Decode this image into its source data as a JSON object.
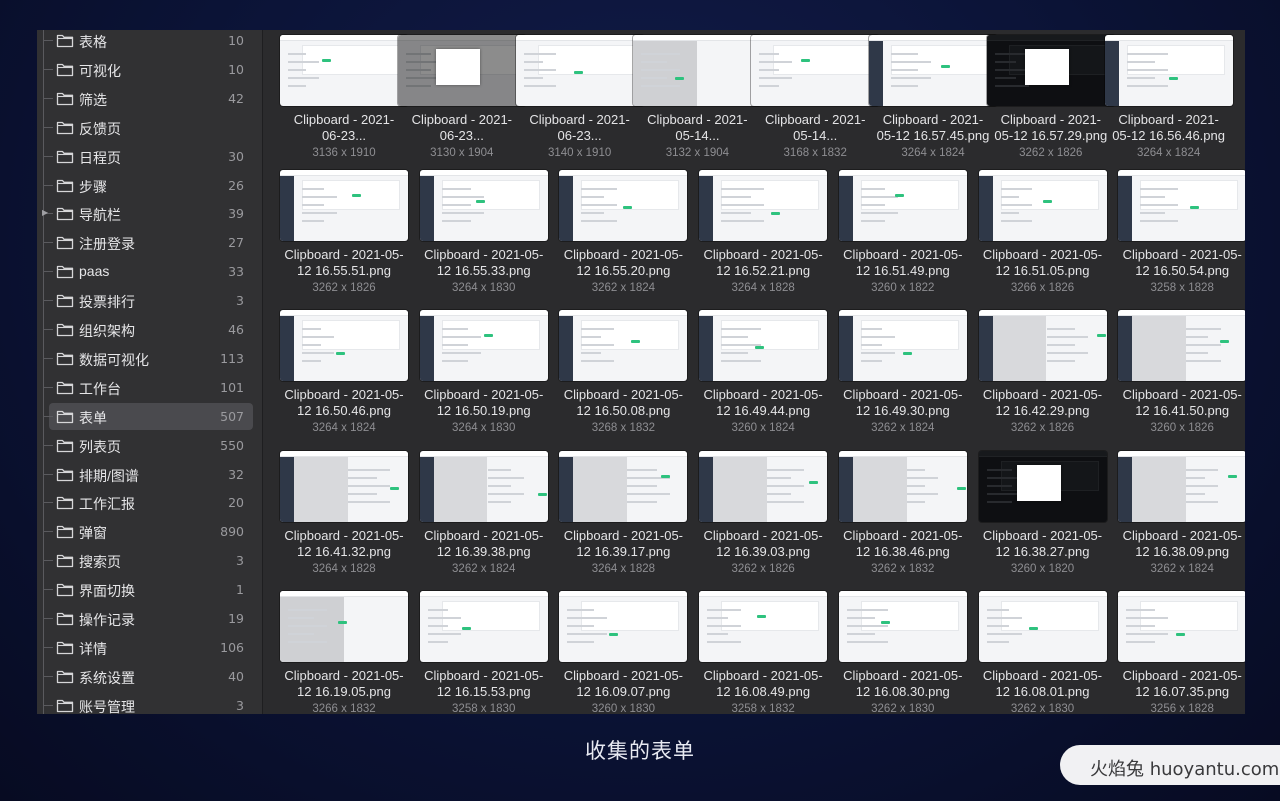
{
  "sidebar": {
    "selected_index": 13,
    "items": [
      {
        "label": "表格",
        "count": "10"
      },
      {
        "label": "可视化",
        "count": "10"
      },
      {
        "label": "筛选",
        "count": "42"
      },
      {
        "label": "反馈页",
        "count": ""
      },
      {
        "label": "日程页",
        "count": "30"
      },
      {
        "label": "步骤",
        "count": "26"
      },
      {
        "label": "导航栏",
        "count": "39",
        "expandable": true
      },
      {
        "label": "注册登录",
        "count": "27"
      },
      {
        "label": "paas",
        "count": "33"
      },
      {
        "label": "投票排行",
        "count": "3"
      },
      {
        "label": "组织架构",
        "count": "46"
      },
      {
        "label": "数据可视化",
        "count": "113"
      },
      {
        "label": "工作台",
        "count": "101"
      },
      {
        "label": "表单",
        "count": "507"
      },
      {
        "label": "列表页",
        "count": "550"
      },
      {
        "label": "排期/图谱",
        "count": "32"
      },
      {
        "label": "工作汇报",
        "count": "20"
      },
      {
        "label": "弹窗",
        "count": "890"
      },
      {
        "label": "搜索页",
        "count": "3"
      },
      {
        "label": "界面切换",
        "count": "1"
      },
      {
        "label": "操作记录",
        "count": "19"
      },
      {
        "label": "详情",
        "count": "106"
      },
      {
        "label": "系统设置",
        "count": "40"
      },
      {
        "label": "账号管理",
        "count": "3"
      }
    ]
  },
  "files": [
    {
      "line1": "Clipboard - 2021-",
      "line2": "06-23...",
      "dims": "3136 x 1910",
      "style": "plain"
    },
    {
      "line1": "Clipboard - 2021-",
      "line2": "06-23...",
      "dims": "3130 x 1904",
      "style": "modal"
    },
    {
      "line1": "Clipboard - 2021-",
      "line2": "06-23...",
      "dims": "3140 x 1910",
      "style": "plain"
    },
    {
      "line1": "Clipboard - 2021-",
      "line2": "05-14...",
      "dims": "3132 x 1904",
      "style": "split"
    },
    {
      "line1": "Clipboard - 2021-",
      "line2": "05-14...",
      "dims": "3168 x 1832",
      "style": "plain"
    },
    {
      "line1": "Clipboard - 2021-",
      "line2": "05-12 16.57.45.png",
      "dims": "3264 x 1824",
      "style": "nav"
    },
    {
      "line1": "Clipboard - 2021-",
      "line2": "05-12 16.57.29.png",
      "dims": "3262 x 1826",
      "style": "darkmodal"
    },
    {
      "line1": "Clipboard - 2021-",
      "line2": "05-12 16.56.46.png",
      "dims": "3264 x 1824",
      "style": "nav"
    },
    {
      "line1": "Clipboard - 2021-05-",
      "line2": "12 16.55.51.png",
      "dims": "3262 x 1826",
      "style": "nav"
    },
    {
      "line1": "Clipboard - 2021-05-",
      "line2": "12 16.55.33.png",
      "dims": "3264 x 1830",
      "style": "nav"
    },
    {
      "line1": "Clipboard - 2021-05-",
      "line2": "12 16.55.20.png",
      "dims": "3262 x 1824",
      "style": "nav"
    },
    {
      "line1": "Clipboard - 2021-05-",
      "line2": "12 16.52.21.png",
      "dims": "3264 x 1828",
      "style": "nav"
    },
    {
      "line1": "Clipboard - 2021-05-",
      "line2": "12 16.51.49.png",
      "dims": "3260 x 1822",
      "style": "nav"
    },
    {
      "line1": "Clipboard - 2021-05-",
      "line2": "12 16.51.05.png",
      "dims": "3266 x 1826",
      "style": "nav"
    },
    {
      "line1": "Clipboard - 2021-05-",
      "line2": "12 16.50.54.png",
      "dims": "3258 x 1828",
      "style": "nav"
    },
    {
      "line1": "Clipboard - 2021-05-",
      "line2": "12 16.50.46.png",
      "dims": "3264 x 1824",
      "style": "nav"
    },
    {
      "line1": "Clipboard - 2021-05-",
      "line2": "12 16.50.19.png",
      "dims": "3264 x 1830",
      "style": "nav"
    },
    {
      "line1": "Clipboard - 2021-05-",
      "line2": "12 16.50.08.png",
      "dims": "3268 x 1832",
      "style": "nav"
    },
    {
      "line1": "Clipboard - 2021-05-",
      "line2": "12 16.49.44.png",
      "dims": "3260 x 1824",
      "style": "nav"
    },
    {
      "line1": "Clipboard - 2021-05-",
      "line2": "12 16.49.30.png",
      "dims": "3262 x 1824",
      "style": "nav"
    },
    {
      "line1": "Clipboard - 2021-05-",
      "line2": "12 16.42.29.png",
      "dims": "3262 x 1826",
      "style": "grayside"
    },
    {
      "line1": "Clipboard - 2021-05-",
      "line2": "12 16.41.50.png",
      "dims": "3260 x 1826",
      "style": "grayside"
    },
    {
      "line1": "Clipboard - 2021-05-",
      "line2": "12 16.41.32.png",
      "dims": "3264 x 1828",
      "style": "grayside"
    },
    {
      "line1": "Clipboard - 2021-05-",
      "line2": "12 16.39.38.png",
      "dims": "3262 x 1824",
      "style": "grayside"
    },
    {
      "line1": "Clipboard - 2021-05-",
      "line2": "12 16.39.17.png",
      "dims": "3264 x 1828",
      "style": "grayside"
    },
    {
      "line1": "Clipboard - 2021-05-",
      "line2": "12 16.39.03.png",
      "dims": "3262 x 1826",
      "style": "grayside"
    },
    {
      "line1": "Clipboard - 2021-05-",
      "line2": "12 16.38.46.png",
      "dims": "3262 x 1832",
      "style": "grayside"
    },
    {
      "line1": "Clipboard - 2021-05-",
      "line2": "12 16.38.27.png",
      "dims": "3260 x 1820",
      "style": "darkmodal"
    },
    {
      "line1": "Clipboard - 2021-05-",
      "line2": "12 16.38.09.png",
      "dims": "3262 x 1824",
      "style": "grayside"
    },
    {
      "line1": "Clipboard - 2021-05-",
      "line2": "12 16.19.05.png",
      "dims": "3266 x 1832",
      "style": "split"
    },
    {
      "line1": "Clipboard - 2021-05-",
      "line2": "12 16.15.53.png",
      "dims": "3258 x 1830",
      "style": "plain"
    },
    {
      "line1": "Clipboard - 2021-05-",
      "line2": "12 16.09.07.png",
      "dims": "3260 x 1830",
      "style": "plain"
    },
    {
      "line1": "Clipboard - 2021-05-",
      "line2": "12 16.08.49.png",
      "dims": "3258 x 1832",
      "style": "plain"
    },
    {
      "line1": "Clipboard - 2021-05-",
      "line2": "12 16.08.30.png",
      "dims": "3262 x 1830",
      "style": "plain"
    },
    {
      "line1": "Clipboard - 2021-05-",
      "line2": "12 16.08.01.png",
      "dims": "3262 x 1830",
      "style": "plain"
    },
    {
      "line1": "Clipboard - 2021-05-",
      "line2": "12 16.07.35.png",
      "dims": "3256 x 1828",
      "style": "plain"
    }
  ],
  "caption": "收集的表单",
  "watermark": "火焰兔 huoyantu.com",
  "colors": {
    "accent": "#2ec27e",
    "selected": "#4a4a4e"
  }
}
